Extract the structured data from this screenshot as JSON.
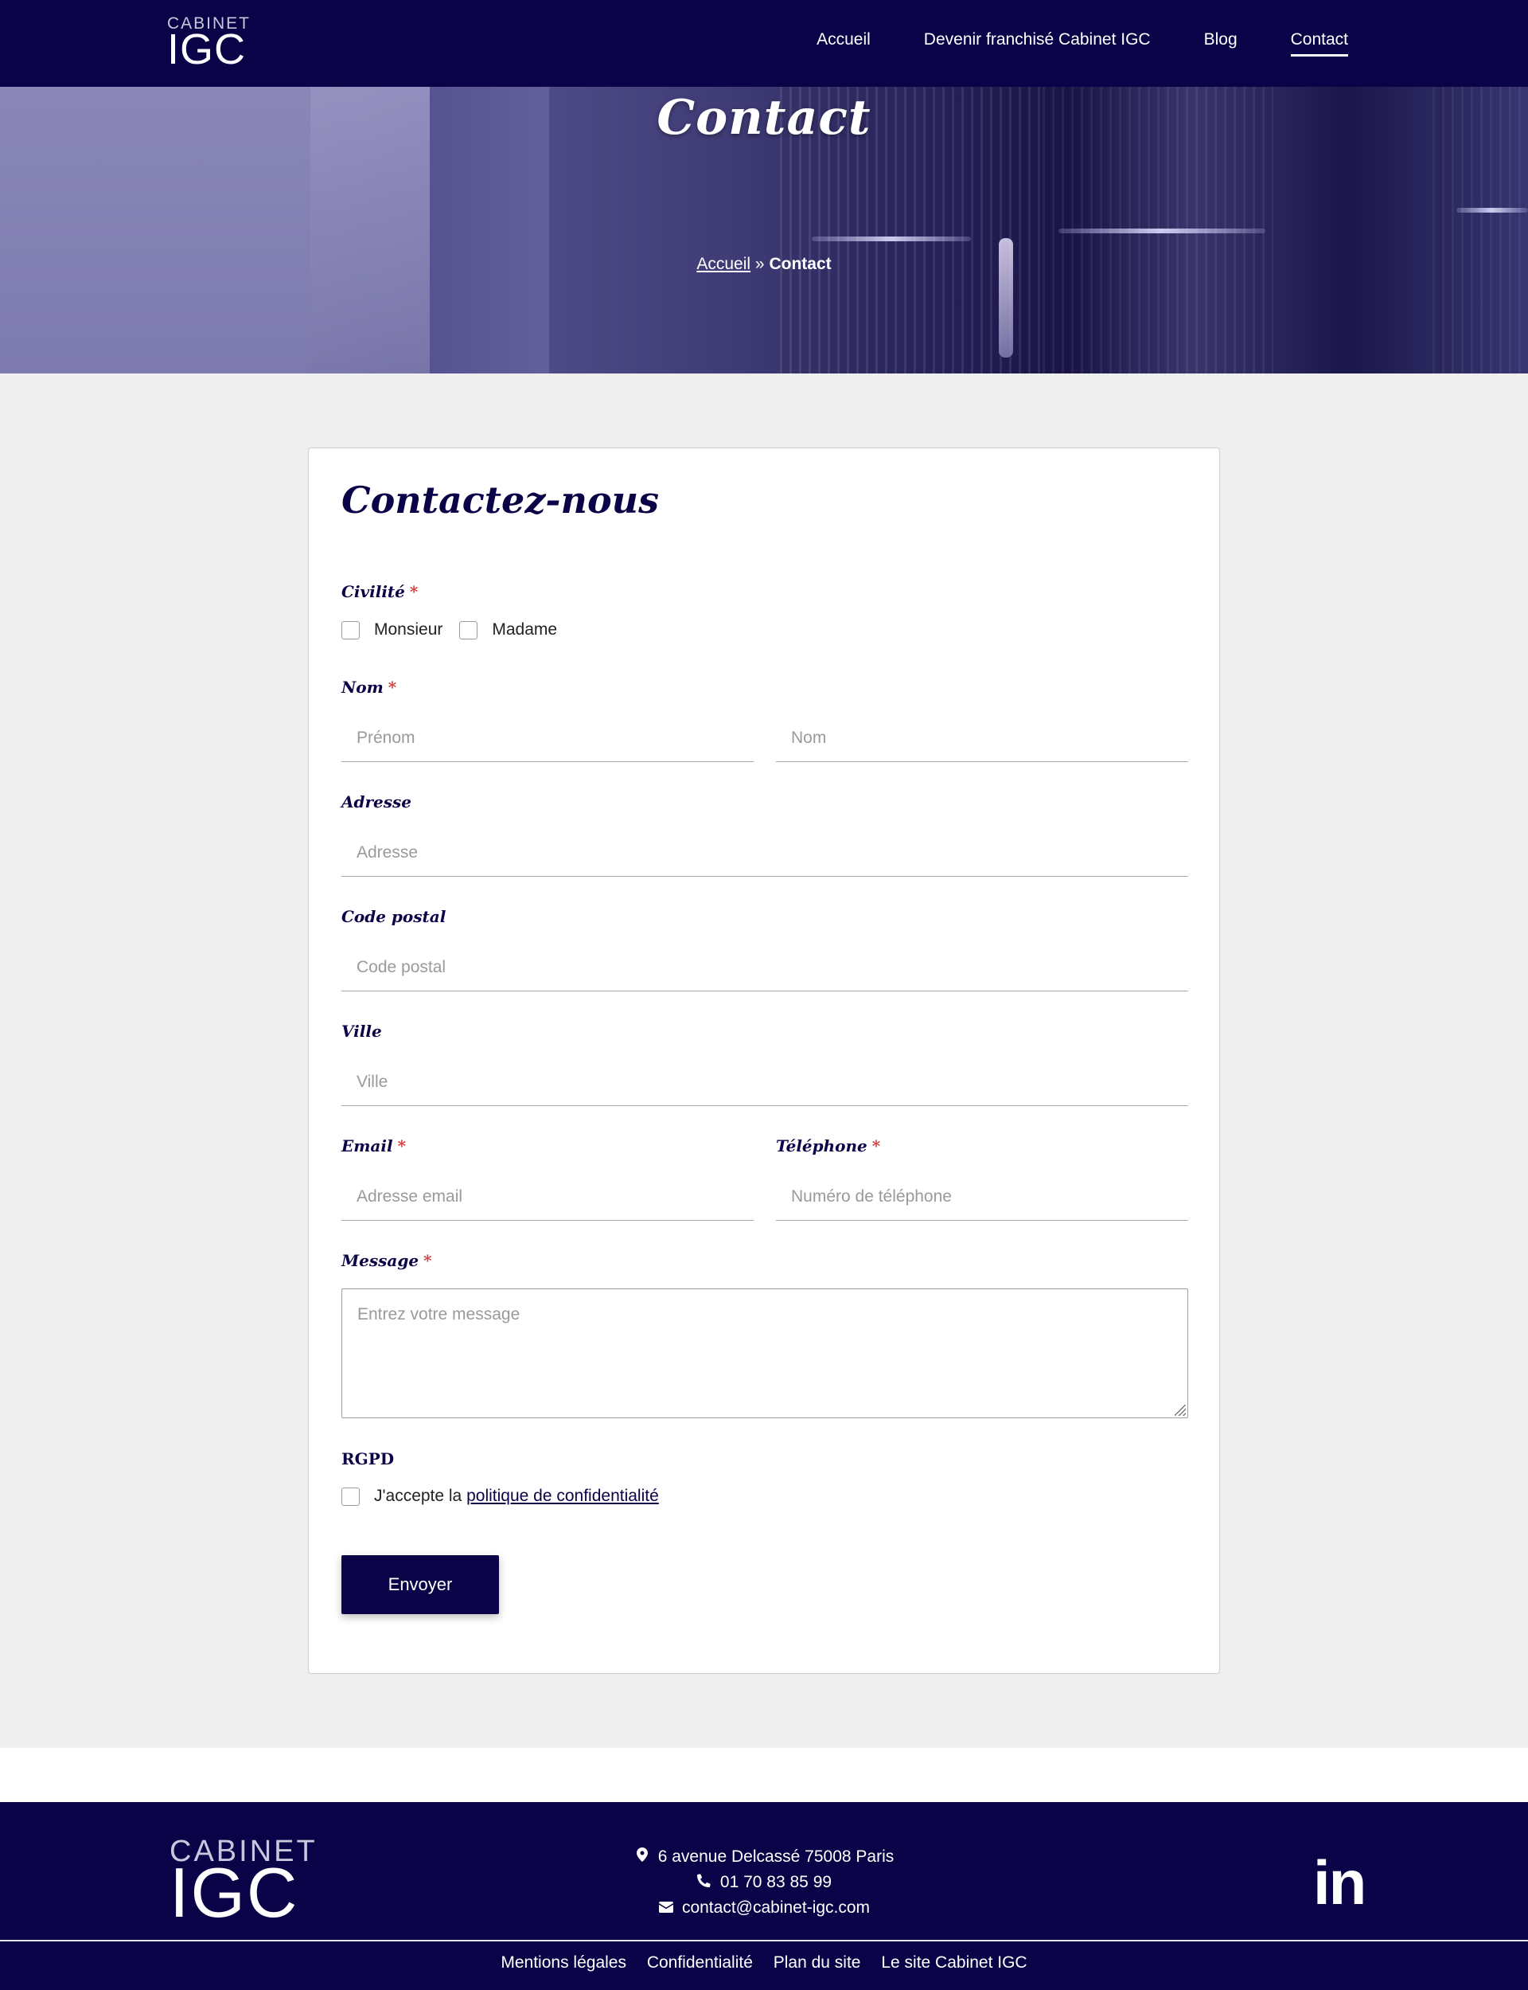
{
  "header": {
    "logo_small": "CABINET",
    "logo_big": "IGC",
    "nav": [
      {
        "label": "Accueil"
      },
      {
        "label": "Devenir franchisé Cabinet IGC"
      },
      {
        "label": "Blog"
      },
      {
        "label": "Contact"
      }
    ]
  },
  "hero": {
    "title": "Contact",
    "breadcrumb_home": "Accueil",
    "breadcrumb_separator": "»",
    "breadcrumb_current": "Contact"
  },
  "form": {
    "title": "Contactez-nous",
    "required_mark": "*",
    "civilite": {
      "label": "Civilité",
      "options": [
        "Monsieur",
        "Madame"
      ]
    },
    "nom": {
      "label": "Nom",
      "first_placeholder": "Prénom",
      "last_placeholder": "Nom"
    },
    "adresse": {
      "label": "Adresse",
      "placeholder": "Adresse"
    },
    "code_postal": {
      "label": "Code postal",
      "placeholder": "Code postal"
    },
    "ville": {
      "label": "Ville",
      "placeholder": "Ville"
    },
    "email": {
      "label": "Email",
      "placeholder": "Adresse email"
    },
    "telephone": {
      "label": "Téléphone",
      "placeholder": "Numéro de téléphone"
    },
    "message": {
      "label": "Message",
      "placeholder": "Entrez votre message"
    },
    "rgpd": {
      "label": "RGPD",
      "accept_text": "J'accepte la",
      "link_text": "politique de confidentialité"
    },
    "submit_label": "Envoyer"
  },
  "footer": {
    "logo_small": "CABINET",
    "logo_big": "IGC",
    "address": "6 avenue Delcassé 75008 Paris",
    "phone": "01 70 83 85 99",
    "email": "contact@cabinet-igc.com",
    "social": "in",
    "links": [
      "Mentions légales",
      "Confidentialité",
      "Plan du site",
      "Le site Cabinet IGC"
    ]
  },
  "colors": {
    "brand_navy": "#0a0347",
    "required_red": "#d23b3b",
    "page_bg": "#efefef"
  },
  "icons": [
    "map-pin-icon",
    "phone-icon",
    "envelope-icon",
    "linkedin-icon"
  ]
}
